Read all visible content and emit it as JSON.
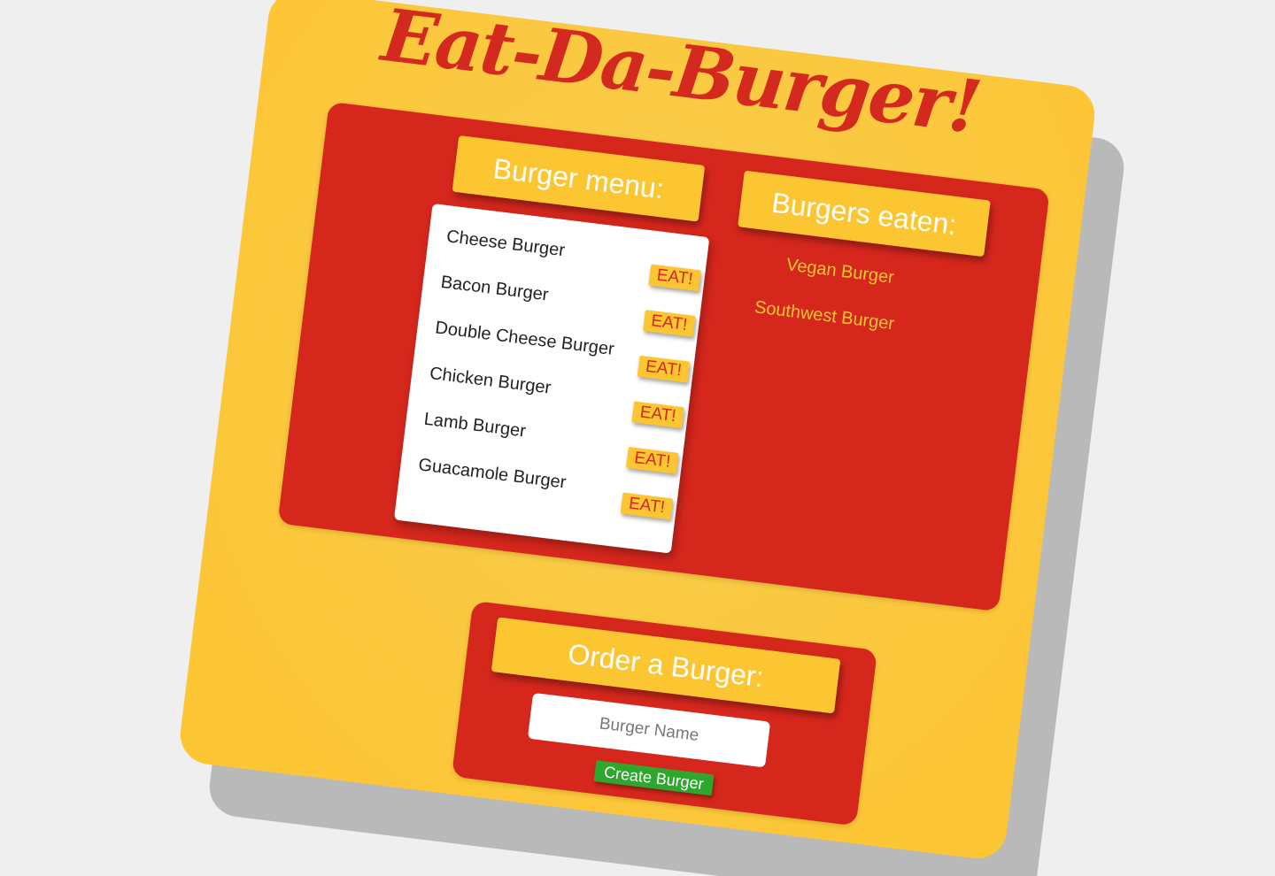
{
  "app": {
    "title": "Eat-Da-Burger!"
  },
  "menu": {
    "heading": "Burger menu:",
    "eat_label": "EAT!",
    "items": [
      {
        "name": "Cheese Burger"
      },
      {
        "name": "Bacon Burger"
      },
      {
        "name": "Double Cheese Burger"
      },
      {
        "name": "Chicken Burger"
      },
      {
        "name": "Lamb Burger"
      },
      {
        "name": "Guacamole Burger"
      }
    ]
  },
  "eaten": {
    "heading": "Burgers eaten:",
    "items": [
      {
        "name": "Vegan Burger"
      },
      {
        "name": "Southwest Burger"
      }
    ]
  },
  "order": {
    "heading": "Order a Burger:",
    "input_placeholder": "Burger Name",
    "input_value": "",
    "submit_label": "Create Burger"
  },
  "colors": {
    "page_background": "#efefef",
    "card_yellow": "#fcc532",
    "panel_red": "#d6271c",
    "title_red": "#d3291f",
    "create_green": "#2fa62d"
  }
}
